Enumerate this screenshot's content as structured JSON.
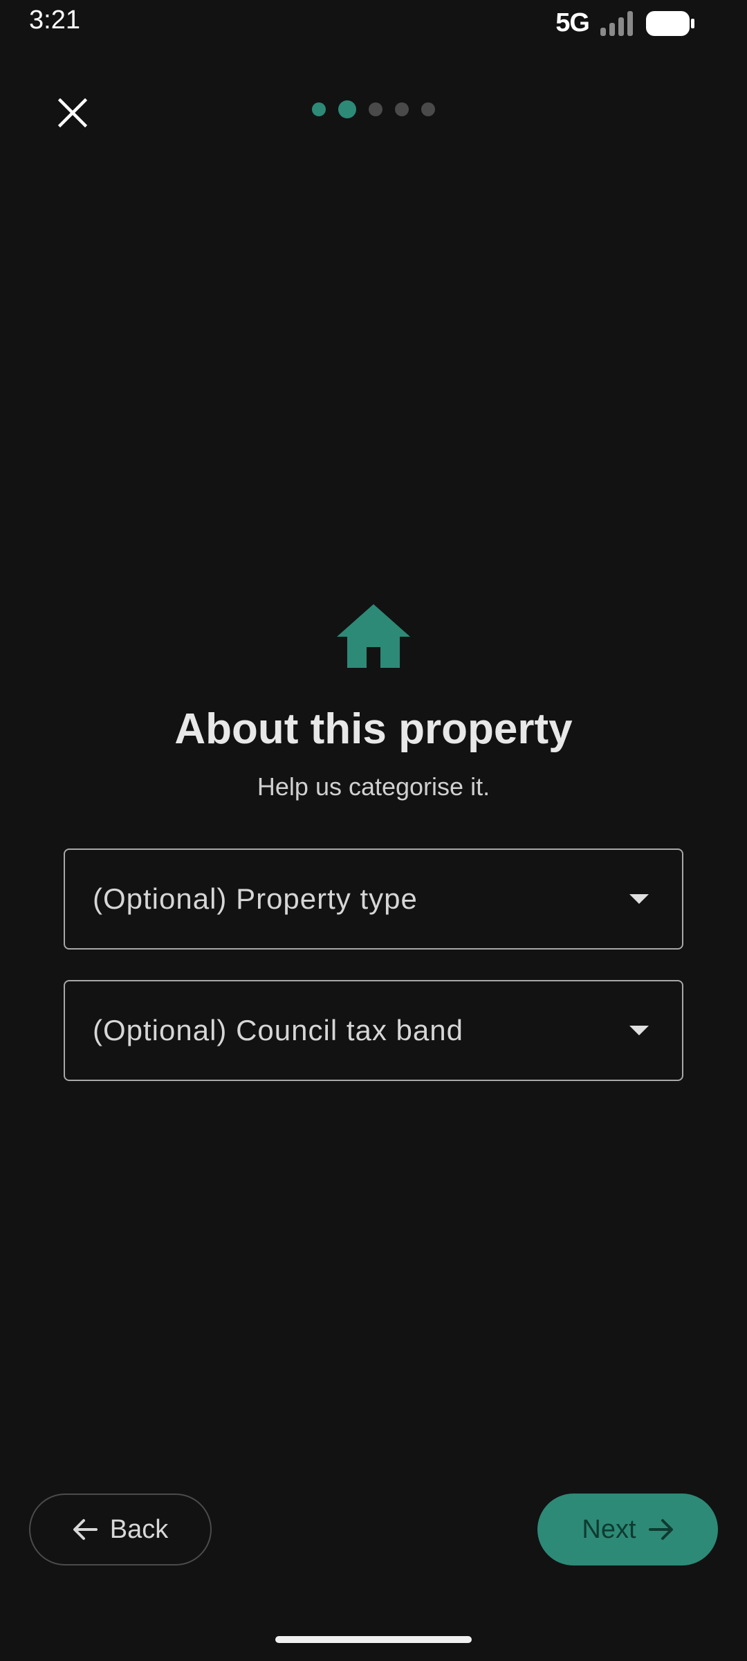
{
  "status_bar": {
    "time": "3:21",
    "network": "5G",
    "signal_icon": "signal-bars-icon",
    "battery_icon": "battery-full-icon"
  },
  "header": {
    "close_icon": "close-icon",
    "progress": {
      "total_steps": 5,
      "current_step": 2
    }
  },
  "main": {
    "icon": "house-icon",
    "title": "About this property",
    "subtitle": "Help us categorise it.",
    "fields": [
      {
        "label": "(Optional) Property type",
        "icon": "chevron-down-icon"
      },
      {
        "label": "(Optional) Council tax band",
        "icon": "chevron-down-icon"
      }
    ]
  },
  "footer": {
    "back_label": "Back",
    "back_icon": "arrow-left-icon",
    "next_label": "Next",
    "next_icon": "arrow-right-icon"
  },
  "colors": {
    "background": "#121212",
    "accent": "#2d8a76",
    "next_text": "#0e3b31",
    "dot_inactive": "#4a4a4a"
  }
}
